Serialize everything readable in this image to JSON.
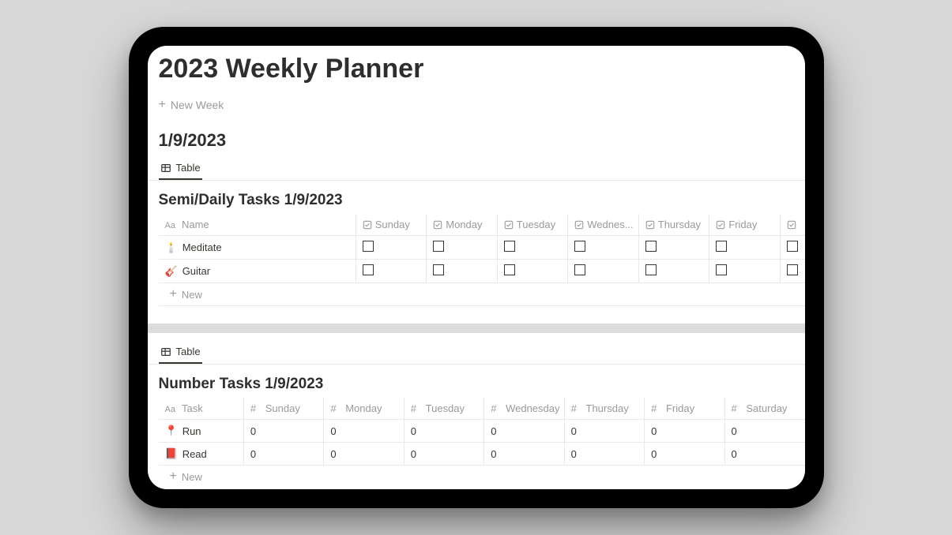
{
  "page": {
    "title": "2023 Weekly Planner",
    "new_week_label": "New Week",
    "date_heading": "1/9/2023"
  },
  "views": {
    "table_label": "Table"
  },
  "daily": {
    "heading": "Semi/Daily Tasks 1/9/2023",
    "name_header": "Name",
    "columns": [
      "Sunday",
      "Monday",
      "Tuesday",
      "Wednes...",
      "Thursday",
      "Friday"
    ],
    "rows": [
      {
        "emoji": "🕯️",
        "name": "Meditate"
      },
      {
        "emoji": "🎸",
        "name": "Guitar"
      }
    ],
    "new_label": "New"
  },
  "number": {
    "heading": "Number Tasks 1/9/2023",
    "task_header": "Task",
    "columns": [
      "Sunday",
      "Monday",
      "Tuesday",
      "Wednesday",
      "Thursday",
      "Friday",
      "Saturday"
    ],
    "rows": [
      {
        "emoji": "📍",
        "name": "Run",
        "values": [
          0,
          0,
          0,
          0,
          0,
          0,
          0
        ]
      },
      {
        "emoji": "📕",
        "name": "Read",
        "values": [
          0,
          0,
          0,
          0,
          0,
          0,
          0
        ]
      }
    ],
    "new_label": "New"
  }
}
